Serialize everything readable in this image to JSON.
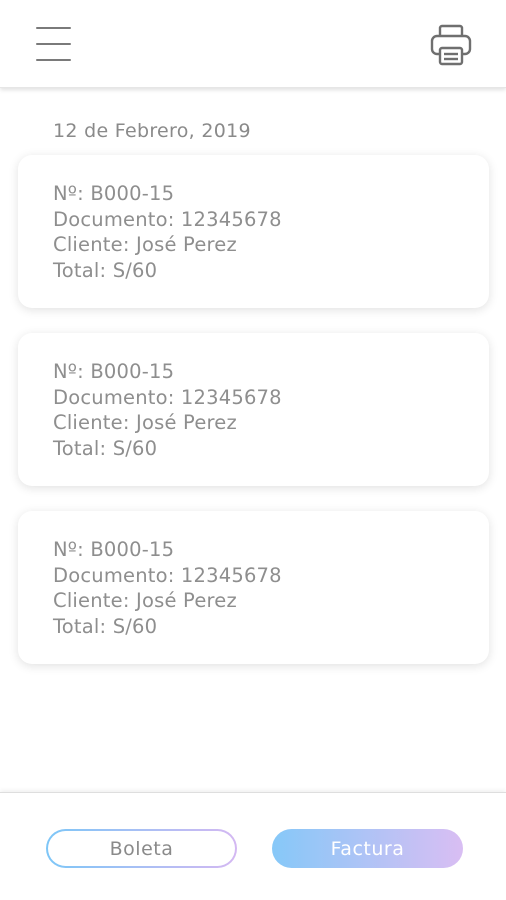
{
  "header": {
    "menu_icon": "hamburger-menu-icon",
    "print_icon": "printer-icon"
  },
  "date_label": "12 de Febrero, 2019",
  "receipts": [
    {
      "number": "Nº: B000-15",
      "document": "Documento: 12345678",
      "client": "Cliente: José Perez",
      "total": "Total: S/60"
    },
    {
      "number": "Nº: B000-15",
      "document": "Documento: 12345678",
      "client": "Cliente: José Perez",
      "total": "Total: S/60"
    },
    {
      "number": "Nº: B000-15",
      "document": "Documento: 12345678",
      "client": "Cliente: José Perez",
      "total": "Total: S/60"
    }
  ],
  "footer": {
    "boleta_label": "Boleta",
    "factura_label": "Factura"
  },
  "colors": {
    "gradient_start": "#7dc6f7",
    "gradient_end": "#d4b8f2",
    "text": "#8e8e8e"
  }
}
